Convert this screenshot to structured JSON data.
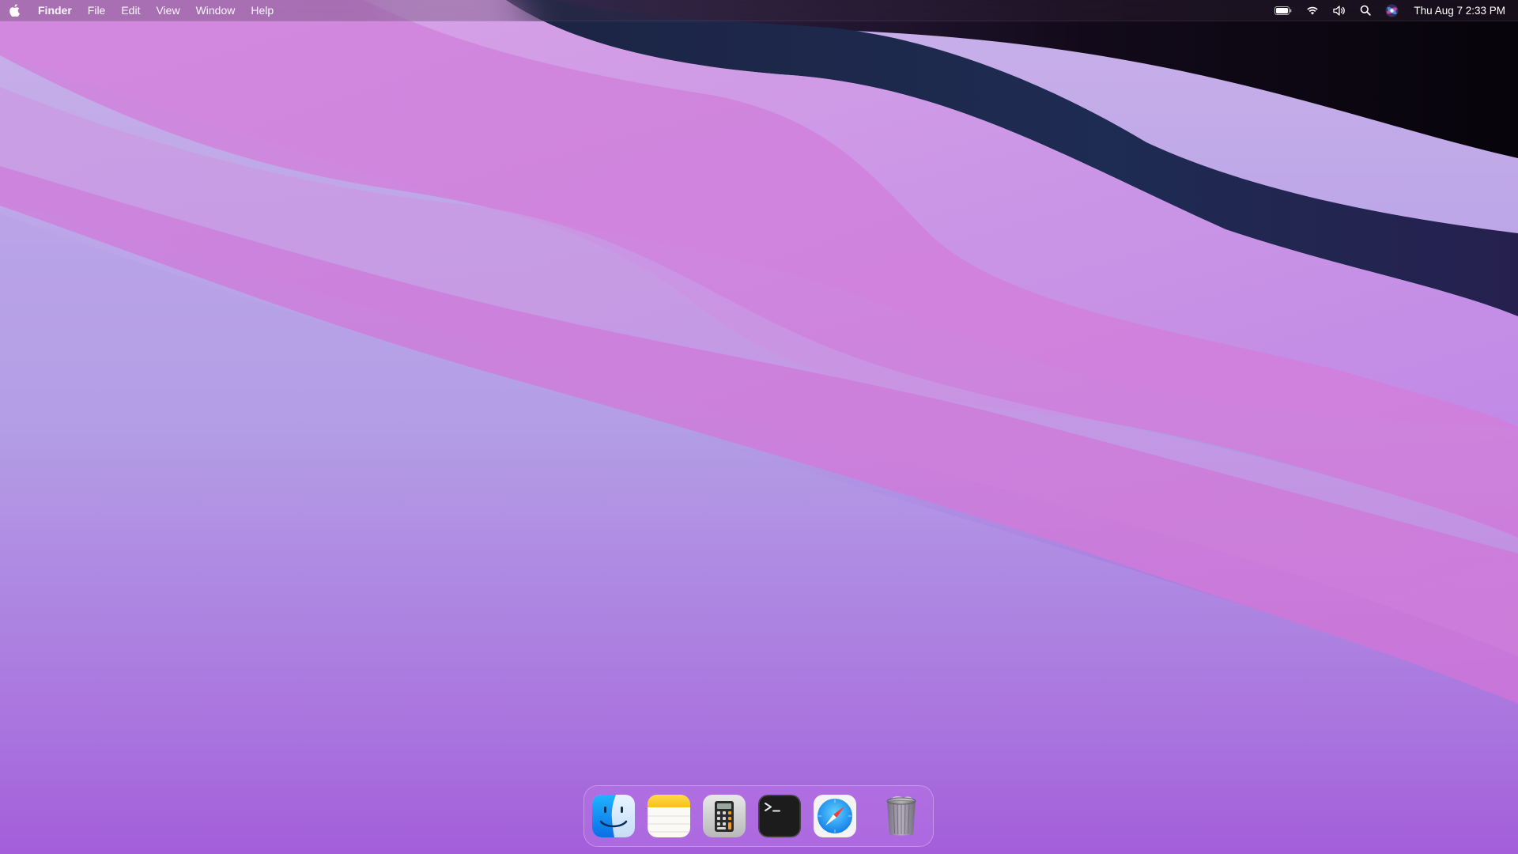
{
  "menubar": {
    "apple_icon": "apple-logo-icon",
    "app_name": "Finder",
    "menus": [
      "File",
      "Edit",
      "View",
      "Window",
      "Help"
    ],
    "status_icons": [
      "battery-icon",
      "wifi-icon",
      "volume-icon",
      "spotlight-search-icon",
      "siri-icon"
    ],
    "clock": "Thu Aug 7  2:33 PM"
  },
  "dock": {
    "apps": [
      {
        "name": "Finder",
        "icon": "finder-icon"
      },
      {
        "name": "Notes",
        "icon": "notes-icon"
      },
      {
        "name": "Calculator",
        "icon": "calculator-icon"
      },
      {
        "name": "Terminal",
        "icon": "terminal-icon"
      },
      {
        "name": "Safari",
        "icon": "safari-icon"
      }
    ],
    "trash": {
      "name": "Trash",
      "icon": "trash-icon"
    }
  },
  "colors": {
    "wallpaper_top": "#c7a6e6",
    "wallpaper_bottom": "#9b3fd6",
    "wave_pink": "#d27fdc",
    "wave_navy": "#1e2a4a",
    "wave_dark": "#0d0812"
  }
}
